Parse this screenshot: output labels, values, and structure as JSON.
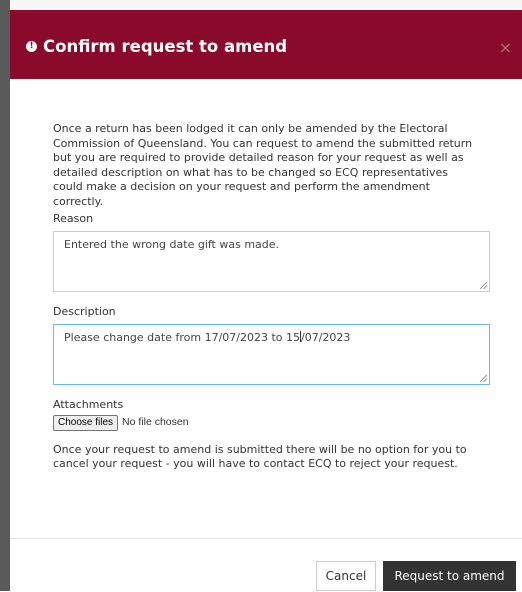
{
  "dialog": {
    "title": "Confirm request to amend",
    "close_symbol": "×",
    "intro_lines": [
      "Once a return has been lodged it can only be amended by the Electoral",
      "Commission of Queensland. You can request to amend the submitted return",
      "but you are required to provide detailed reason for your request as well as",
      "detailed description on what has to be changed so ECQ representatives",
      "could make a decision on your request and perform the amendment",
      "correctly."
    ],
    "reason": {
      "label": "Reason",
      "value": "Entered the wrong date gift was made."
    },
    "description": {
      "label": "Description",
      "value_before_caret": "Please change date from 17/07/2023 to 15",
      "value_after_caret": "/07/2023"
    },
    "attachments": {
      "label": "Attachments",
      "button_label": "Choose files",
      "status": "No file chosen"
    },
    "warning_lines": [
      "Once your request to amend is submitted there will be no option for you to",
      "cancel your request - you will have to contact ECQ to reject your request."
    ],
    "footer": {
      "cancel_label": "Cancel",
      "submit_label": "Request to amend"
    }
  },
  "icons": {
    "alert": "alert-circle-icon",
    "close": "close-icon"
  },
  "colors": {
    "header_bg": "#8a0a2c",
    "primary_button_bg": "#333333",
    "focus_border": "#6ab8e8"
  }
}
